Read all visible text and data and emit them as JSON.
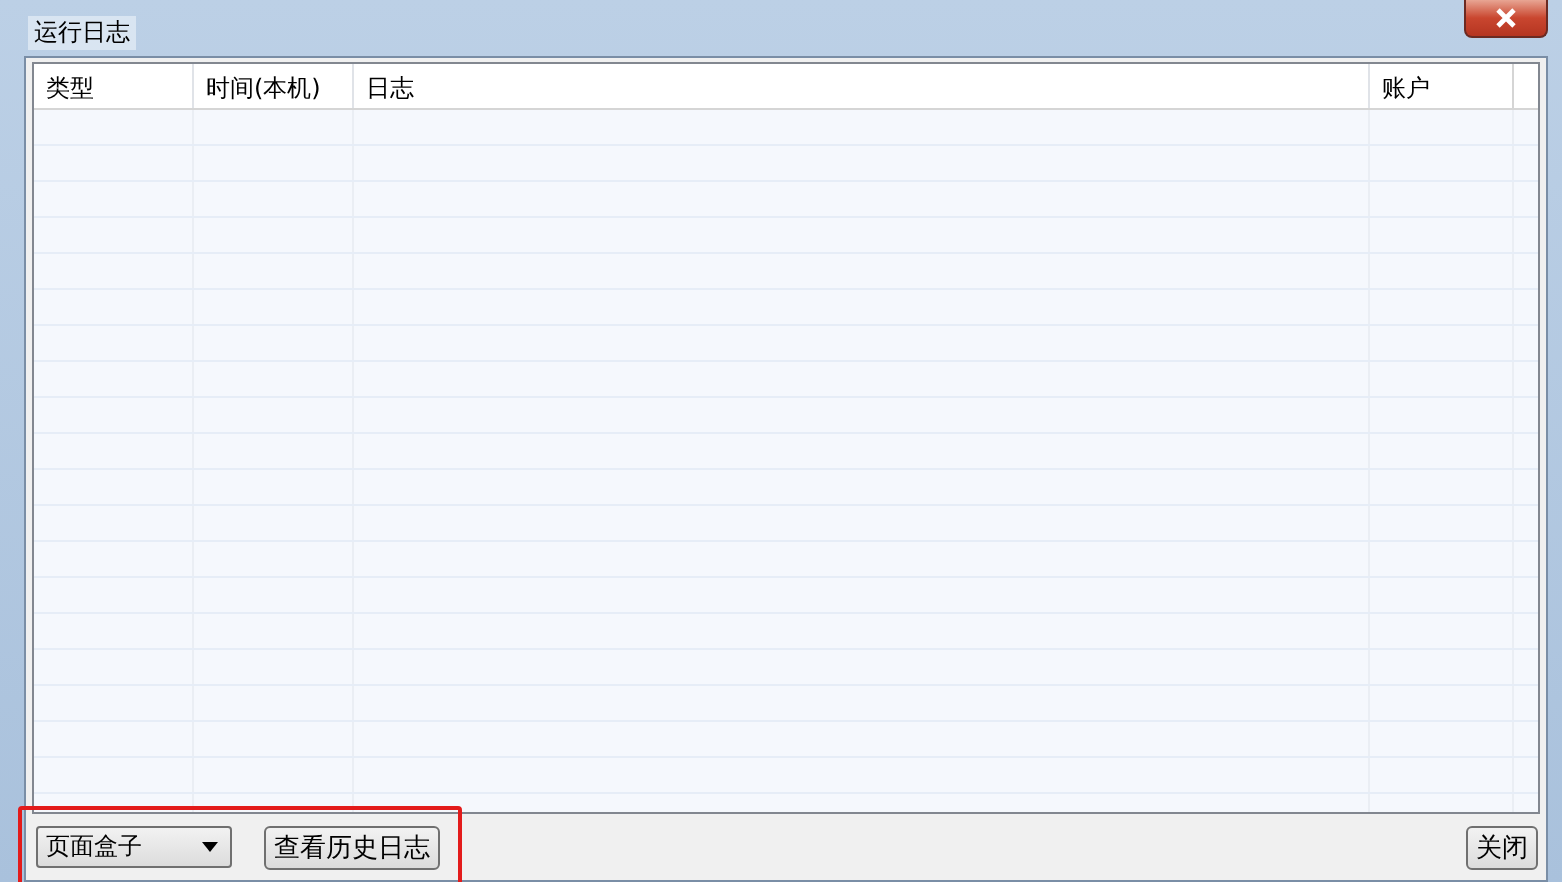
{
  "window": {
    "title": "运行日志"
  },
  "table": {
    "columns": [
      "类型",
      "时间(本机)",
      "日志",
      "账户"
    ]
  },
  "footer": {
    "dropdown": {
      "value": "页面盒子"
    },
    "buttons": [
      {
        "label": "查看历史日志",
        "highlighted": true
      },
      {
        "label": "关闭",
        "highlighted": false
      }
    ]
  }
}
